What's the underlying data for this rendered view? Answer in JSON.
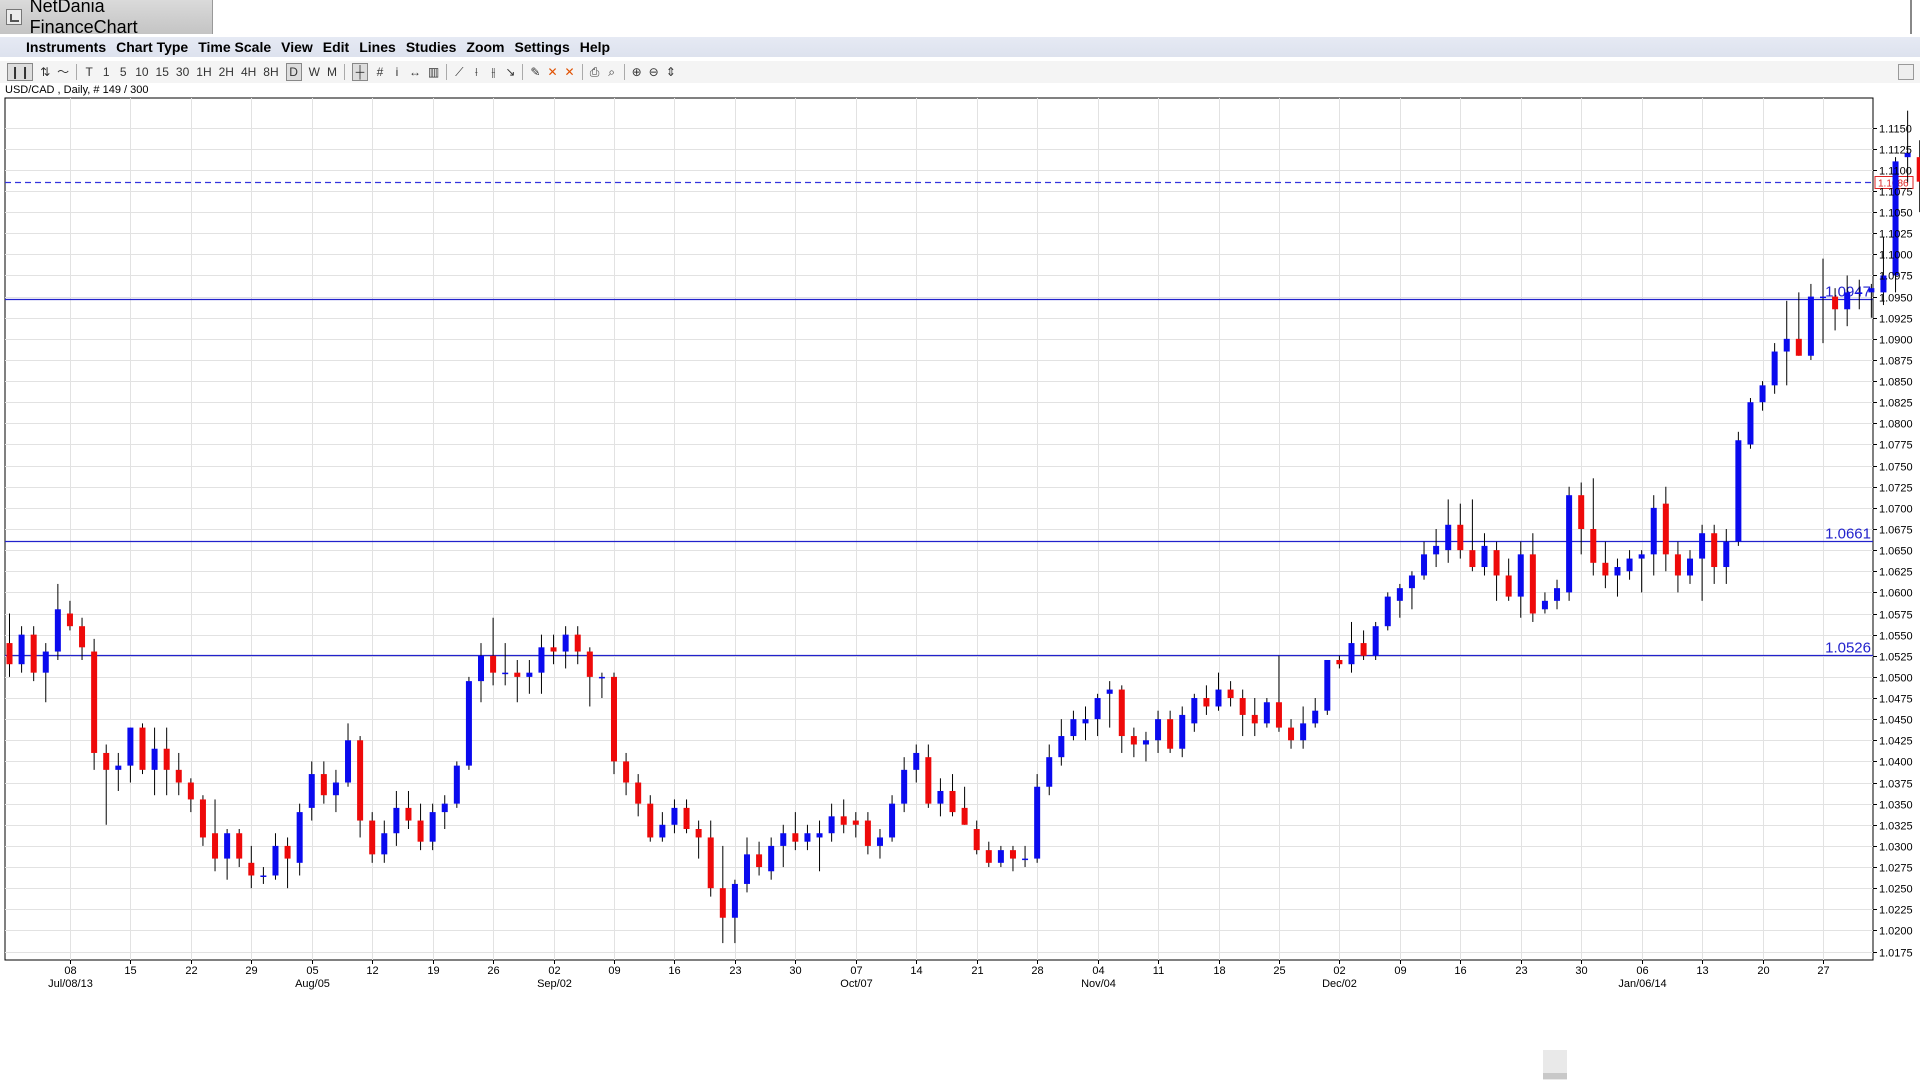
{
  "window": {
    "title": "NetDania FinanceChart"
  },
  "menu": [
    "Instruments",
    "Chart Type",
    "Time Scale",
    "View",
    "Edit",
    "Lines",
    "Studies",
    "Zoom",
    "Settings",
    "Help"
  ],
  "toolbar": {
    "timeframes": [
      "T",
      "1",
      "5",
      "10",
      "15",
      "30",
      "1H",
      "2H",
      "4H",
      "8H",
      "D",
      "W",
      "M"
    ],
    "active_timeframe": "D"
  },
  "header": {
    "info": "USD/CAD , Daily, # 149 / 300"
  },
  "colors": {
    "up": "#0a0aee",
    "down": "#ee0a0a",
    "hline": "#2222cc",
    "current": "#3333dd",
    "grid": "#e2e2e2"
  },
  "chart_data": {
    "type": "candlestick",
    "instrument": "USD/CAD",
    "timeframe": "Daily",
    "ylim": [
      1.0165,
      1.1185
    ],
    "y_ticks": [
      "1.1150",
      "1.1125",
      "1.1100",
      "1.1075",
      "1.1050",
      "1.1025",
      "1.1000",
      "1.0975",
      "1.0950",
      "1.0925",
      "1.0900",
      "1.0875",
      "1.0850",
      "1.0825",
      "1.0800",
      "1.0775",
      "1.0750",
      "1.0725",
      "1.0700",
      "1.0675",
      "1.0650",
      "1.0625",
      "1.0600",
      "1.0575",
      "1.0550",
      "1.0525",
      "1.0500",
      "1.0475",
      "1.0450",
      "1.0425",
      "1.0400",
      "1.0375",
      "1.0350",
      "1.0325",
      "1.0300",
      "1.0275",
      "1.0250",
      "1.0225",
      "1.0200",
      "1.0175"
    ],
    "x_ticks": [
      {
        "day": "08",
        "month": "Jul/08/13"
      },
      {
        "day": "15"
      },
      {
        "day": "22"
      },
      {
        "day": "29"
      },
      {
        "day": "05",
        "month": "Aug/05"
      },
      {
        "day": "12"
      },
      {
        "day": "19"
      },
      {
        "day": "26"
      },
      {
        "day": "02",
        "month": "Sep/02"
      },
      {
        "day": "09"
      },
      {
        "day": "16"
      },
      {
        "day": "23"
      },
      {
        "day": "30"
      },
      {
        "day": "07",
        "month": "Oct/07"
      },
      {
        "day": "14"
      },
      {
        "day": "21"
      },
      {
        "day": "28"
      },
      {
        "day": "04",
        "month": "Nov/04"
      },
      {
        "day": "11"
      },
      {
        "day": "18"
      },
      {
        "day": "25"
      },
      {
        "day": "02",
        "month": "Dec/02"
      },
      {
        "day": "09"
      },
      {
        "day": "16"
      },
      {
        "day": "23"
      },
      {
        "day": "30"
      },
      {
        "day": "06",
        "month": "Jan/06/14"
      },
      {
        "day": "13"
      },
      {
        "day": "20"
      },
      {
        "day": "27"
      }
    ],
    "hlines": [
      {
        "value": 1.0947,
        "label": "1.0947"
      },
      {
        "value": 1.0661,
        "label": "1.0661"
      },
      {
        "value": 1.0526,
        "label": "1.0526"
      }
    ],
    "current_price": {
      "value": 1.1086,
      "label": "1.1086"
    },
    "candles": [
      [
        1.054,
        1.0575,
        1.05,
        1.0515
      ],
      [
        1.0515,
        1.056,
        1.0505,
        1.055
      ],
      [
        1.055,
        1.056,
        1.0495,
        1.0505
      ],
      [
        1.0505,
        1.054,
        1.047,
        1.053
      ],
      [
        1.053,
        1.061,
        1.052,
        1.058
      ],
      [
        1.0575,
        1.059,
        1.0555,
        1.056
      ],
      [
        1.056,
        1.057,
        1.052,
        1.0535
      ],
      [
        1.053,
        1.0545,
        1.039,
        1.041
      ],
      [
        1.041,
        1.042,
        1.0325,
        1.039
      ],
      [
        1.039,
        1.041,
        1.0365,
        1.0395
      ],
      [
        1.0395,
        1.044,
        1.0375,
        1.044
      ],
      [
        1.044,
        1.0445,
        1.0385,
        1.039
      ],
      [
        1.039,
        1.044,
        1.036,
        1.0415
      ],
      [
        1.0415,
        1.044,
        1.036,
        1.039
      ],
      [
        1.039,
        1.041,
        1.036,
        1.0375
      ],
      [
        1.0375,
        1.038,
        1.034,
        1.0355
      ],
      [
        1.0355,
        1.036,
        1.03,
        1.031
      ],
      [
        1.0315,
        1.0355,
        1.027,
        1.0285
      ],
      [
        1.0285,
        1.032,
        1.026,
        1.0315
      ],
      [
        1.0315,
        1.032,
        1.0275,
        1.0285
      ],
      [
        1.028,
        1.03,
        1.025,
        1.0265
      ],
      [
        1.0265,
        1.0275,
        1.0255,
        1.0265
      ],
      [
        1.0265,
        1.0315,
        1.026,
        1.03
      ],
      [
        1.03,
        1.031,
        1.025,
        1.0285
      ],
      [
        1.028,
        1.035,
        1.0265,
        1.034
      ],
      [
        1.0345,
        1.04,
        1.033,
        1.0385
      ],
      [
        1.0385,
        1.04,
        1.035,
        1.036
      ],
      [
        1.036,
        1.039,
        1.034,
        1.0375
      ],
      [
        1.0375,
        1.0445,
        1.037,
        1.0425
      ],
      [
        1.0425,
        1.043,
        1.031,
        1.033
      ],
      [
        1.033,
        1.034,
        1.028,
        1.029
      ],
      [
        1.029,
        1.033,
        1.028,
        1.0315
      ],
      [
        1.0315,
        1.0365,
        1.03,
        1.0345
      ],
      [
        1.0345,
        1.0365,
        1.032,
        1.033
      ],
      [
        1.033,
        1.035,
        1.0295,
        1.0305
      ],
      [
        1.0305,
        1.035,
        1.0295,
        1.034
      ],
      [
        1.034,
        1.036,
        1.032,
        1.035
      ],
      [
        1.035,
        1.04,
        1.0345,
        1.0395
      ],
      [
        1.0395,
        1.05,
        1.039,
        1.0495
      ],
      [
        1.0495,
        1.054,
        1.047,
        1.0525
      ],
      [
        1.0525,
        1.057,
        1.049,
        1.0505
      ],
      [
        1.0505,
        1.054,
        1.049,
        1.0505
      ],
      [
        1.0505,
        1.052,
        1.047,
        1.05
      ],
      [
        1.05,
        1.052,
        1.048,
        1.0505
      ],
      [
        1.0505,
        1.055,
        1.048,
        1.0535
      ],
      [
        1.0535,
        1.055,
        1.0515,
        1.053
      ],
      [
        1.053,
        1.056,
        1.051,
        1.055
      ],
      [
        1.055,
        1.056,
        1.0515,
        1.053
      ],
      [
        1.053,
        1.0535,
        1.0465,
        1.05
      ],
      [
        1.05,
        1.0505,
        1.0475,
        1.05
      ],
      [
        1.05,
        1.0505,
        1.0385,
        1.04
      ],
      [
        1.04,
        1.041,
        1.036,
        1.0375
      ],
      [
        1.0375,
        1.0385,
        1.0335,
        1.035
      ],
      [
        1.035,
        1.036,
        1.0305,
        1.031
      ],
      [
        1.031,
        1.034,
        1.0305,
        1.0325
      ],
      [
        1.0325,
        1.0355,
        1.0315,
        1.0345
      ],
      [
        1.0345,
        1.0355,
        1.0315,
        1.032
      ],
      [
        1.032,
        1.033,
        1.0285,
        1.031
      ],
      [
        1.031,
        1.033,
        1.024,
        1.025
      ],
      [
        1.025,
        1.03,
        1.0185,
        1.0215
      ],
      [
        1.0215,
        1.026,
        1.0185,
        1.0255
      ],
      [
        1.0255,
        1.031,
        1.0245,
        1.029
      ],
      [
        1.029,
        1.0305,
        1.0265,
        1.0275
      ],
      [
        1.027,
        1.031,
        1.026,
        1.03
      ],
      [
        1.03,
        1.0325,
        1.0275,
        1.0315
      ],
      [
        1.0315,
        1.034,
        1.0295,
        1.0305
      ],
      [
        1.0305,
        1.0325,
        1.0295,
        1.0315
      ],
      [
        1.031,
        1.033,
        1.027,
        1.0315
      ],
      [
        1.0315,
        1.035,
        1.0305,
        1.0335
      ],
      [
        1.0335,
        1.0355,
        1.0315,
        1.0325
      ],
      [
        1.033,
        1.034,
        1.031,
        1.0325
      ],
      [
        1.033,
        1.034,
        1.029,
        1.03
      ],
      [
        1.03,
        1.032,
        1.0285,
        1.031
      ],
      [
        1.031,
        1.036,
        1.0305,
        1.035
      ],
      [
        1.035,
        1.0405,
        1.034,
        1.039
      ],
      [
        1.039,
        1.042,
        1.0375,
        1.041
      ],
      [
        1.0405,
        1.042,
        1.0345,
        1.035
      ],
      [
        1.035,
        1.038,
        1.0335,
        1.0365
      ],
      [
        1.0365,
        1.0385,
        1.0335,
        1.034
      ],
      [
        1.0345,
        1.037,
        1.0325,
        1.0325
      ],
      [
        1.032,
        1.033,
        1.029,
        1.0295
      ],
      [
        1.0295,
        1.0305,
        1.0275,
        1.028
      ],
      [
        1.028,
        1.03,
        1.0275,
        1.0295
      ],
      [
        1.0295,
        1.03,
        1.027,
        1.0285
      ],
      [
        1.0285,
        1.03,
        1.0275,
        1.0285
      ],
      [
        1.0285,
        1.0385,
        1.028,
        1.037
      ],
      [
        1.037,
        1.042,
        1.036,
        1.0405
      ],
      [
        1.0405,
        1.045,
        1.0395,
        1.043
      ],
      [
        1.043,
        1.046,
        1.0425,
        1.045
      ],
      [
        1.0445,
        1.0465,
        1.0425,
        1.045
      ],
      [
        1.045,
        1.048,
        1.043,
        1.0475
      ],
      [
        1.048,
        1.0495,
        1.044,
        1.0485
      ],
      [
        1.0485,
        1.049,
        1.041,
        1.043
      ],
      [
        1.043,
        1.044,
        1.0405,
        1.042
      ],
      [
        1.042,
        1.0435,
        1.04,
        1.0425
      ],
      [
        1.0425,
        1.046,
        1.041,
        1.045
      ],
      [
        1.045,
        1.046,
        1.041,
        1.0415
      ],
      [
        1.0415,
        1.0465,
        1.0405,
        1.0455
      ],
      [
        1.0445,
        1.048,
        1.0435,
        1.0475
      ],
      [
        1.0475,
        1.049,
        1.0455,
        1.0465
      ],
      [
        1.0465,
        1.0505,
        1.046,
        1.0485
      ],
      [
        1.0485,
        1.0495,
        1.0465,
        1.0475
      ],
      [
        1.0475,
        1.0485,
        1.043,
        1.0455
      ],
      [
        1.0455,
        1.0475,
        1.043,
        1.0445
      ],
      [
        1.0445,
        1.0475,
        1.044,
        1.047
      ],
      [
        1.047,
        1.0525,
        1.0435,
        1.044
      ],
      [
        1.044,
        1.045,
        1.0415,
        1.0425
      ],
      [
        1.0425,
        1.0465,
        1.0415,
        1.0445
      ],
      [
        1.0445,
        1.0475,
        1.044,
        1.046
      ],
      [
        1.046,
        1.052,
        1.0455,
        1.052
      ],
      [
        1.052,
        1.0525,
        1.051,
        1.0515
      ],
      [
        1.0515,
        1.0565,
        1.0505,
        1.054
      ],
      [
        1.054,
        1.0555,
        1.052,
        1.0525
      ],
      [
        1.0525,
        1.0565,
        1.052,
        1.056
      ],
      [
        1.056,
        1.06,
        1.0555,
        1.0595
      ],
      [
        1.059,
        1.061,
        1.057,
        1.0605
      ],
      [
        1.0605,
        1.0625,
        1.058,
        1.062
      ],
      [
        1.062,
        1.066,
        1.0615,
        1.0645
      ],
      [
        1.0645,
        1.0675,
        1.063,
        1.0655
      ],
      [
        1.065,
        1.071,
        1.0635,
        1.068
      ],
      [
        1.068,
        1.0705,
        1.064,
        1.065
      ],
      [
        1.065,
        1.071,
        1.0625,
        1.063
      ],
      [
        1.063,
        1.067,
        1.062,
        1.0655
      ],
      [
        1.065,
        1.066,
        1.059,
        1.062
      ],
      [
        1.062,
        1.064,
        1.059,
        1.0595
      ],
      [
        1.0595,
        1.066,
        1.057,
        1.0645
      ],
      [
        1.0645,
        1.067,
        1.0565,
        1.0575
      ],
      [
        1.058,
        1.06,
        1.0575,
        1.059
      ],
      [
        1.059,
        1.0615,
        1.058,
        1.0605
      ],
      [
        1.06,
        1.0725,
        1.059,
        1.0715
      ],
      [
        1.0715,
        1.073,
        1.0645,
        1.0675
      ],
      [
        1.0675,
        1.0735,
        1.062,
        1.0635
      ],
      [
        1.0635,
        1.066,
        1.0605,
        1.062
      ],
      [
        1.062,
        1.064,
        1.0595,
        1.063
      ],
      [
        1.0625,
        1.065,
        1.0615,
        1.064
      ],
      [
        1.064,
        1.065,
        1.06,
        1.0645
      ],
      [
        1.0645,
        1.0715,
        1.062,
        1.07
      ],
      [
        1.0705,
        1.0725,
        1.0625,
        1.0645
      ],
      [
        1.0645,
        1.066,
        1.06,
        1.062
      ],
      [
        1.062,
        1.065,
        1.061,
        1.064
      ],
      [
        1.064,
        1.068,
        1.059,
        1.067
      ],
      [
        1.067,
        1.068,
        1.061,
        1.063
      ],
      [
        1.063,
        1.0675,
        1.061,
        1.066
      ],
      [
        1.066,
        1.079,
        1.0655,
        1.078
      ],
      [
        1.0775,
        1.083,
        1.077,
        1.0825
      ],
      [
        1.0825,
        1.085,
        1.0815,
        1.0845
      ],
      [
        1.0845,
        1.0895,
        1.0835,
        1.0885
      ],
      [
        1.0885,
        1.0945,
        1.0845,
        1.09
      ],
      [
        1.09,
        1.0955,
        1.088,
        1.088
      ],
      [
        1.088,
        1.0965,
        1.0875,
        1.095
      ],
      [
        1.095,
        1.0995,
        1.0895,
        1.095
      ],
      [
        1.095,
        1.096,
        1.091,
        1.0935
      ],
      [
        1.0935,
        1.0975,
        1.0915,
        1.0955
      ],
      [
        1.0955,
        1.097,
        1.0935,
        1.0955
      ],
      [
        1.0955,
        1.0965,
        1.0925,
        1.096
      ],
      [
        1.0955,
        1.102,
        1.094,
        1.0975
      ],
      [
        1.0975,
        1.1115,
        1.0955,
        1.111
      ],
      [
        1.1115,
        1.117,
        1.1085,
        1.112
      ],
      [
        1.1115,
        1.1135,
        1.105,
        1.1086
      ]
    ]
  }
}
